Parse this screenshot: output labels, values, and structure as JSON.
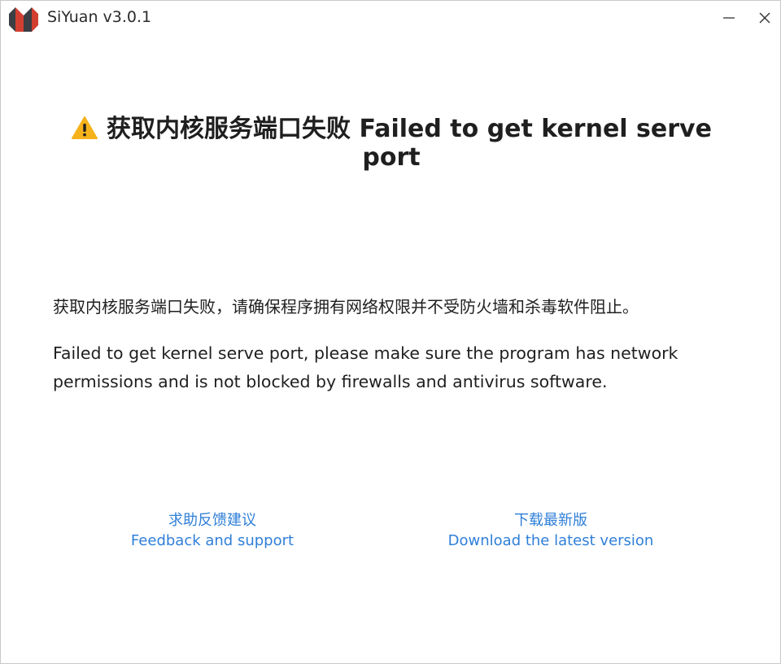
{
  "window": {
    "title": "SiYuan v3.0.1"
  },
  "icons": {
    "app_logo": "siyuan-logo",
    "warning": "warning-triangle-icon",
    "minimize": "minimize-icon",
    "close": "close-icon"
  },
  "colors": {
    "link": "#2f7fd8",
    "warning": "#f6b21b",
    "logo_red": "#d23f31",
    "logo_dark": "#3b3e43"
  },
  "error": {
    "heading": "获取内核服务端口失败 Failed to get kernel serve port",
    "message_cn": "获取内核服务端口失败，请确保程序拥有网络权限并不受防火墙和杀毒软件阻止。",
    "message_en": "Failed to get kernel serve port, please make sure the program has network permissions and is not blocked by firewalls and antivirus software."
  },
  "links": {
    "feedback_cn": "求助反馈建议",
    "feedback_en": "Feedback and support",
    "download_cn": "下载最新版",
    "download_en": "Download the latest version"
  }
}
